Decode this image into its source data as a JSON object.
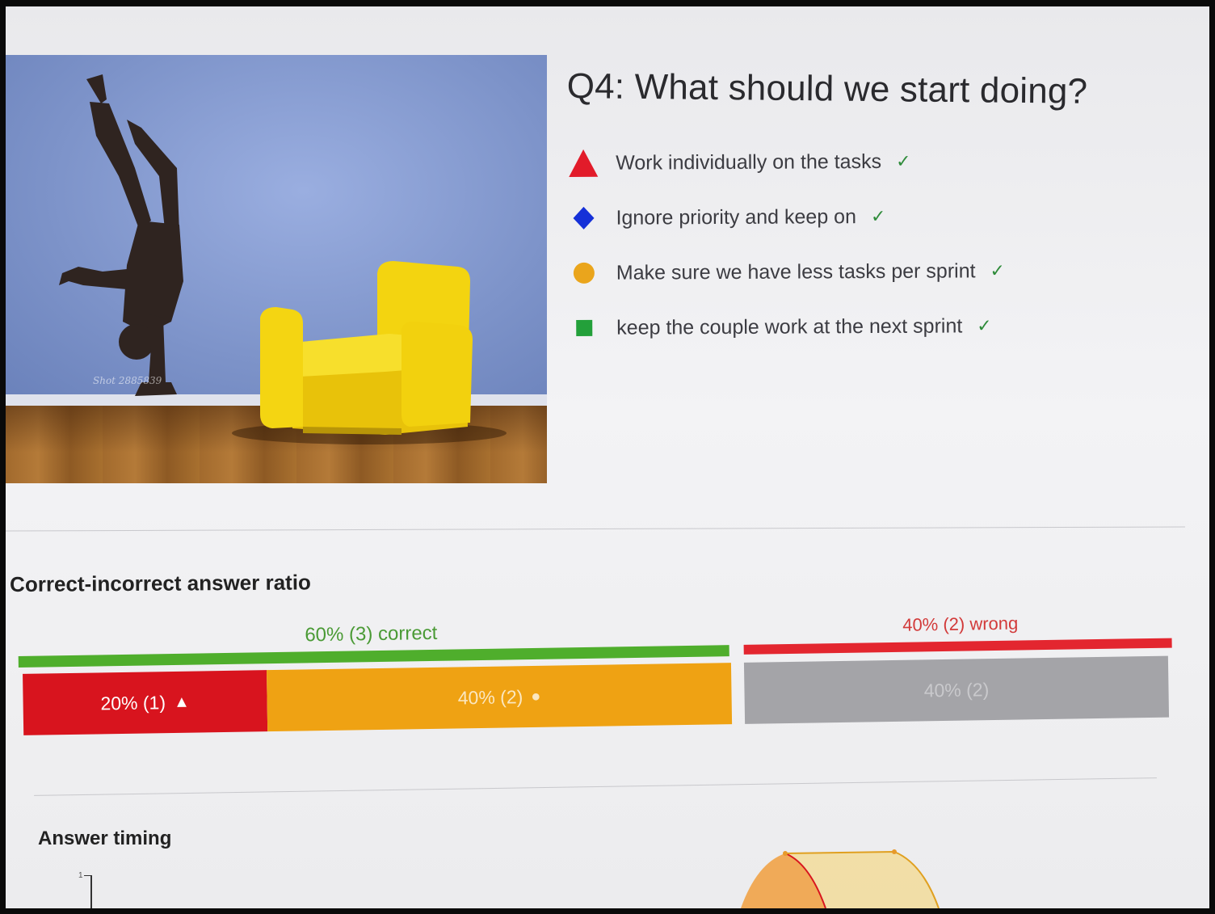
{
  "question": {
    "title": "Q4: What should we start doing?",
    "image": {
      "credit": "Shot 2885839"
    },
    "answers": [
      {
        "shape": "triangle-icon",
        "color": "#e21b2a",
        "label": "Work individually on the tasks",
        "check": "✓"
      },
      {
        "shape": "diamond-icon",
        "color": "#1530d8",
        "label": "Ignore priority and keep on",
        "check": "✓"
      },
      {
        "shape": "circle-icon",
        "color": "#eaa51c",
        "label": "Make sure we have less tasks per sprint",
        "check": "✓"
      },
      {
        "shape": "square-icon",
        "color": "#23a03a",
        "label": "keep the couple work at the next sprint",
        "check": "✓"
      }
    ]
  },
  "ratio": {
    "title": "Correct-incorrect answer ratio",
    "correct_label": "60% (3) correct",
    "wrong_label": "40% (2) wrong",
    "segments": [
      {
        "label": "20% (1)",
        "mark": "▲",
        "value": 20
      },
      {
        "label": "40% (2)",
        "mark": "●",
        "value": 40
      },
      {
        "label": "40% (2)",
        "mark": "",
        "value": 40
      }
    ]
  },
  "timing": {
    "title": "Answer timing",
    "y_tick": "1"
  },
  "colors": {
    "correct": "#4fae2c",
    "wrong": "#e3262f"
  }
}
